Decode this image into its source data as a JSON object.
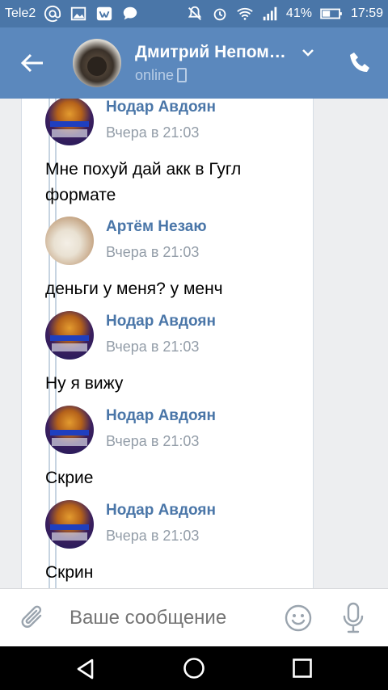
{
  "status_bar": {
    "carrier": "Tele2",
    "battery": "41%",
    "time": "17:59"
  },
  "header": {
    "contact_name": "Дмитрий Непом…",
    "status": "online"
  },
  "messages": [
    {
      "author": "Нодар Авдоян",
      "time": "Вчера в 21:03",
      "text": "Мне похуй дай акк в Гугл формате",
      "avatar": "nodar"
    },
    {
      "author": "Артём Незаю",
      "time": "Вчера в 21:03",
      "text": "деньги у меня? у менч",
      "avatar": "artem"
    },
    {
      "author": "Нодар Авдоян",
      "time": "Вчера в 21:03",
      "text": "Ну я вижу",
      "avatar": "nodar"
    },
    {
      "author": "Нодар Авдоян",
      "time": "Вчера в 21:03",
      "text": "Скрие",
      "avatar": "nodar"
    },
    {
      "author": "Нодар Авдоян",
      "time": "Вчера в 21:03",
      "text": "Скрин",
      "avatar": "nodar"
    }
  ],
  "composer": {
    "placeholder": "Ваше сообщение"
  },
  "colors": {
    "header_bg": "#5b88bd",
    "status_bg": "#4a76a8",
    "link": "#4a76a8",
    "muted": "#939da8"
  }
}
